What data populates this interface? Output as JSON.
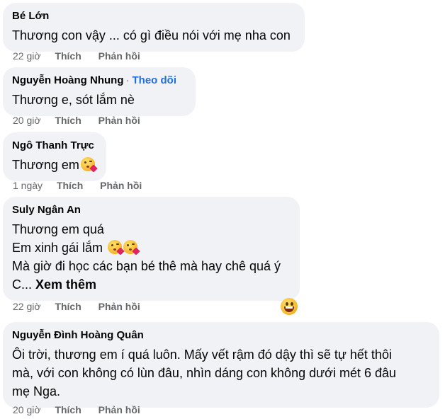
{
  "comments": [
    {
      "author": "Bé Lớn",
      "follow": "",
      "lines": [
        "Thương con vậy ... có gì điều nói với mẹ nha con"
      ],
      "time": "22 giờ",
      "like": "Thích",
      "reply": "Phản hồi"
    },
    {
      "author": "Nguyễn Hoàng Nhung",
      "follow": "Theo dõi",
      "lines": [
        "Thương e, sót lắm nè"
      ],
      "time": "20 giờ",
      "like": "Thích",
      "reply": "Phản hồi"
    },
    {
      "author": "Ngô Thanh Trực",
      "follow": "",
      "lines": [
        "Thương em"
      ],
      "time": "1 ngày",
      "like": "Thích",
      "reply": "Phản hồi"
    },
    {
      "author": "Suly Ngân An",
      "follow": "",
      "lines": [
        "Thương em quá",
        "Em xinh gái lắm",
        "Mà giờ đi học các bạn bé thê mà hay chê quá ý",
        "C..."
      ],
      "see_more": "Xem thêm",
      "time": "22 giờ",
      "like": "Thích",
      "reply": "Phản hồi"
    },
    {
      "author": "Nguyễn Đình Hoàng Quân",
      "follow": "",
      "lines": [
        "Ôi trời, thương em í quá luôn. Mấy vết rậm đó dậy thì sẽ tự hết thôi",
        "mà, với con không có lùn đâu, nhìn dáng con không dưới mét 6 đâu",
        "mẹ Nga."
      ],
      "time": "20 giờ",
      "like": "Thích",
      "reply": "Phản hồi"
    }
  ],
  "separator": "·",
  "emojis": {
    "inline": "face-blowing-kiss-emoji",
    "reaction": "grinning-face-emoji"
  }
}
